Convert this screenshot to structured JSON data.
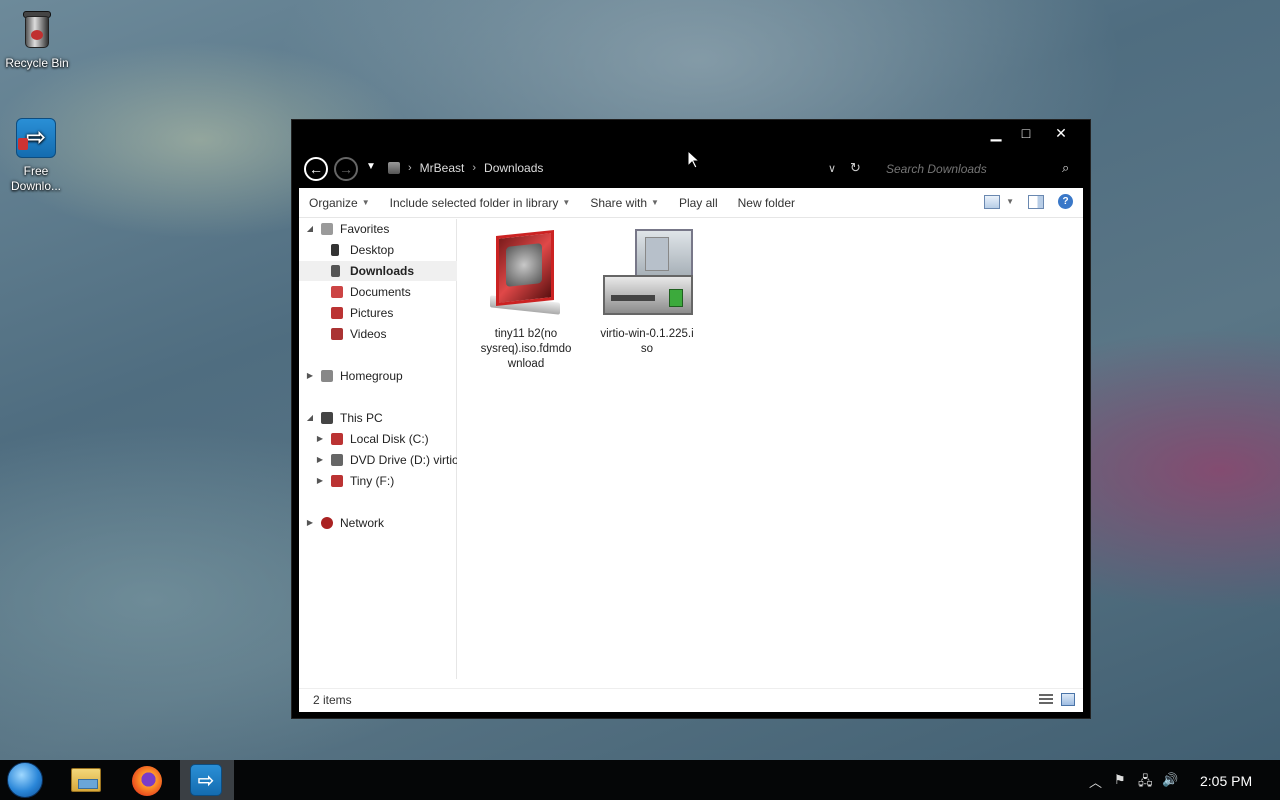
{
  "desktop": {
    "icons": [
      {
        "label": "Recycle Bin"
      },
      {
        "label": "Free Downlo..."
      }
    ]
  },
  "window": {
    "controls": {
      "minimize": "▁",
      "maximize": "□",
      "close": "✕"
    },
    "address": {
      "back": "←",
      "forward": "→",
      "breadcrumbs": [
        "MrBeast",
        "Downloads"
      ],
      "search_placeholder": "Search Downloads"
    },
    "toolbar": {
      "organize": "Organize",
      "include_library": "Include selected folder in library",
      "share_with": "Share with",
      "play_all": "Play all",
      "new_folder": "New folder"
    },
    "nav": {
      "favorites": "Favorites",
      "desktop": "Desktop",
      "downloads": "Downloads",
      "documents": "Documents",
      "pictures": "Pictures",
      "videos": "Videos",
      "homegroup": "Homegroup",
      "this_pc": "This PC",
      "local_disk": "Local Disk (C:)",
      "dvd_drive": "DVD Drive (D:) virtio-win",
      "tiny": "Tiny (F:)",
      "network": "Network"
    },
    "files": [
      {
        "name_lines": [
          "tiny11 b2(no",
          "sysreq).iso.fdmdo",
          "wnload"
        ]
      },
      {
        "name_lines": [
          "virtio-win-0.1.225.i",
          "so"
        ]
      }
    ],
    "status": "2 items"
  },
  "taskbar": {
    "clock": "2:05 PM"
  },
  "colors": {
    "window_chrome": "#000000",
    "selection": "#f0f0f0",
    "taskbar": "#050607"
  }
}
